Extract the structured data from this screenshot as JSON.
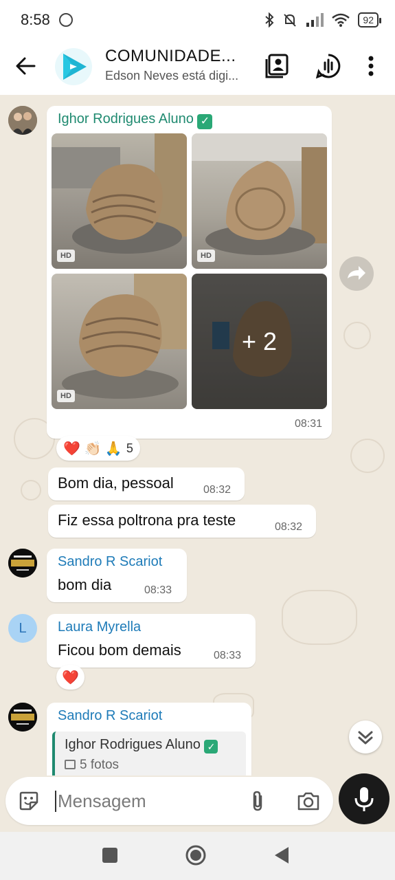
{
  "status_bar": {
    "time": "8:58",
    "battery": "92"
  },
  "header": {
    "title": "COMUNIDADE...",
    "subtitle": "Edson Neves está digi..."
  },
  "messages": {
    "m1": {
      "sender": "Ighor Rodrigues Aluno",
      "time": "08:31",
      "more_photos": "+ 2",
      "hd_label": "HD"
    },
    "m1_reactions": {
      "emojis": "❤️ 👏🏻 🙏",
      "count": "5"
    },
    "m2": {
      "text": "Bom dia, pessoal",
      "time": "08:32"
    },
    "m3": {
      "text": "Fiz essa poltrona pra teste",
      "time": "08:32"
    },
    "m4": {
      "sender": "Sandro R Scariot",
      "text": "bom dia",
      "time": "08:33"
    },
    "m5": {
      "sender": "Laura Myrella",
      "avatar_letter": "L",
      "text": "Ficou bom demais",
      "time": "08:33"
    },
    "m5_reactions": {
      "emojis": "❤️"
    },
    "m6": {
      "sender": "Sandro R Scariot",
      "quoted_sender": "Ighor Rodrigues Aluno",
      "quoted_text": "5 fotos",
      "avatar_text": "SCARIOT"
    }
  },
  "composer": {
    "placeholder": "Mensagem"
  },
  "colors": {
    "accent_green": "#1f8a70",
    "sender_blue": "#1e7bb8",
    "chat_bg": "#efe9de",
    "teal_logo": "#1fb5d3"
  }
}
